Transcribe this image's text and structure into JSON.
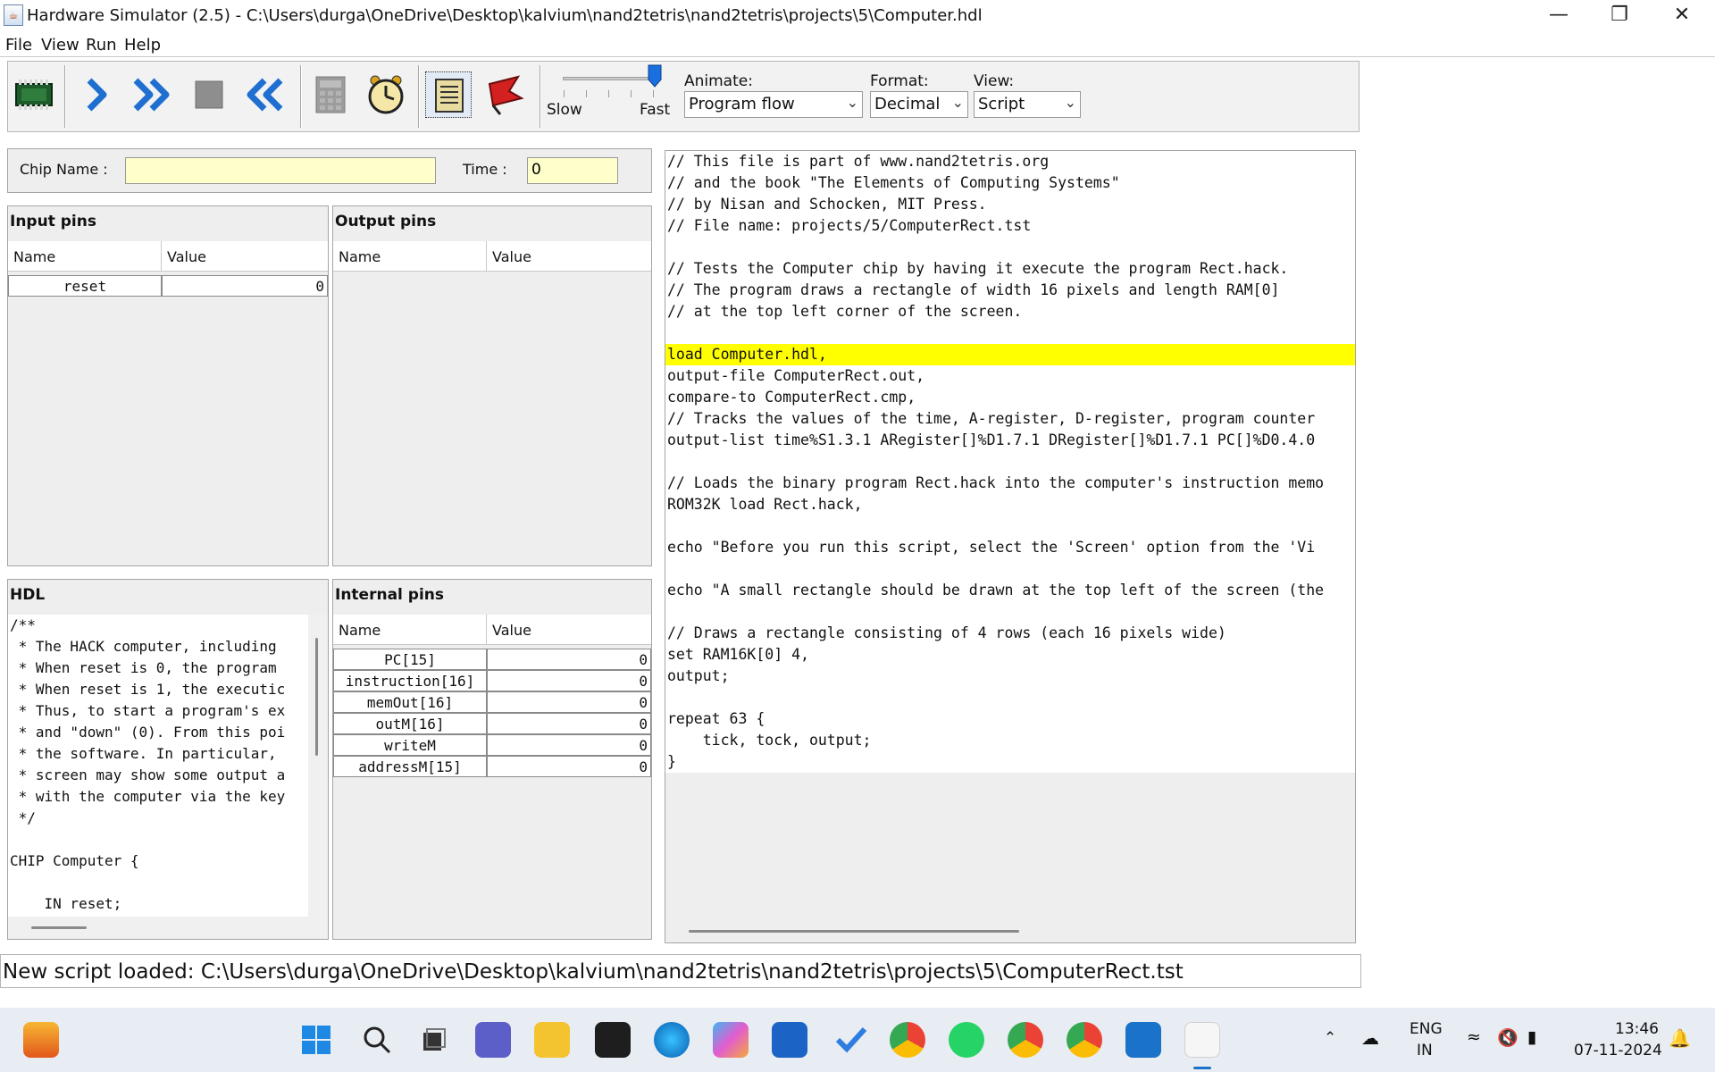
{
  "window": {
    "title": "Hardware Simulator (2.5) - C:\\Users\\durga\\OneDrive\\Desktop\\kalvium\\nand2tetris\\nand2tetris\\projects\\5\\Computer.hdl"
  },
  "menu": [
    "File",
    "View",
    "Run",
    "Help"
  ],
  "toolbar": {
    "speed": {
      "slow_label": "Slow",
      "fast_label": "Fast",
      "level": 1.0
    },
    "animate": {
      "label": "Animate:",
      "value": "Program flow"
    },
    "format": {
      "label": "Format:",
      "value": "Decimal"
    },
    "view": {
      "label": "View:",
      "value": "Script"
    }
  },
  "chip": {
    "name_label": "Chip Name :",
    "name_value": "",
    "time_label": "Time :",
    "time_value": "0"
  },
  "input_pins": {
    "title": "Input pins",
    "columns": [
      "Name",
      "Value"
    ],
    "rows": [
      {
        "name": "reset",
        "value": "0"
      }
    ]
  },
  "output_pins": {
    "title": "Output pins",
    "columns": [
      "Name",
      "Value"
    ]
  },
  "hdl": {
    "title": "HDL",
    "lines": [
      "/**",
      " * The HACK computer, including",
      " * When reset is 0, the program",
      " * When reset is 1, the executic",
      " * Thus, to start a program's ex",
      " * and \"down\" (0). From this poi",
      " * the software. In particular,",
      " * screen may show some output a",
      " * with the computer via the key",
      " */",
      "",
      "CHIP Computer {",
      "",
      "    IN reset;"
    ]
  },
  "internal_pins": {
    "title": "Internal pins",
    "columns": [
      "Name",
      "Value"
    ],
    "rows": [
      {
        "name": "PC[15]",
        "value": "0"
      },
      {
        "name": "instruction[16]",
        "value": "0"
      },
      {
        "name": "memOut[16]",
        "value": "0"
      },
      {
        "name": "outM[16]",
        "value": "0"
      },
      {
        "name": "writeM",
        "value": "0"
      },
      {
        "name": "addressM[15]",
        "value": "0"
      }
    ]
  },
  "script": {
    "highlight_line": 8,
    "lines": [
      "// This file is part of www.nand2tetris.org",
      "// and the book \"The Elements of Computing Systems\"",
      "// by Nisan and Schocken, MIT Press.",
      "// File name: projects/5/ComputerRect.tst",
      "",
      "// Tests the Computer chip by having it execute the program Rect.hack.",
      "// The program draws a rectangle of width 16 pixels and length RAM[0]",
      "// at the top left corner of the screen.",
      "",
      "load Computer.hdl,",
      "output-file ComputerRect.out,",
      "compare-to ComputerRect.cmp,",
      "// Tracks the values of the time, A-register, D-register, program counter",
      "output-list time%S1.3.1 ARegister[]%D1.7.1 DRegister[]%D1.7.1 PC[]%D0.4.0",
      "",
      "// Loads the binary program Rect.hack into the computer's instruction memo",
      "ROM32K load Rect.hack,",
      "",
      "echo \"Before you run this script, select the 'Screen' option from the 'Vi",
      "",
      "echo \"A small rectangle should be drawn at the top left of the screen (the",
      "",
      "// Draws a rectangle consisting of 4 rows (each 16 pixels wide)",
      "set RAM16K[0] 4,",
      "output;",
      "",
      "repeat 63 {",
      "    tick, tock, output;",
      "}"
    ]
  },
  "status": "New script loaded: C:\\Users\\durga\\OneDrive\\Desktop\\kalvium\\nand2tetris\\nand2tetris\\projects\\5\\ComputerRect.tst",
  "tray": {
    "lang_top": "ENG",
    "lang_bottom": "IN",
    "time": "13:46",
    "date": "07-11-2024"
  }
}
